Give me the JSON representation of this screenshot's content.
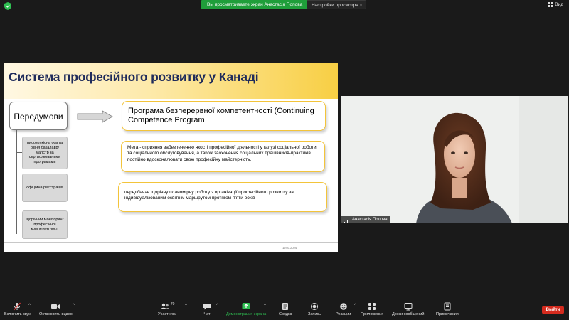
{
  "top_bar": {
    "share_banner": "Вы просматриваете экран Анастасія Попова",
    "view_settings": "Настройки просмотра",
    "view_button": "Вид"
  },
  "slide": {
    "title": "Система професійного розвитку у Канаді",
    "prerequisites_label": "Передумови",
    "prerequisites": [
      "високоякісна освіта рівня бакалавр/магістр за сертифікованими програмами",
      "офіційна реєстрація",
      "щорічний моніторинг професійної компетентності"
    ],
    "program": "Програма безперервної компетентності (Continuing Competence Program",
    "goal": "Мета - сприяння забезпеченню якості професійної діяльності у галузі соціальної роботи та соціального обслуговування, а також заохочення соціальних працівників-практиків постійно вдосконалювати свою професійну майстерність.",
    "plan": "передбачає щорічну планомірну роботу з організації професійного розвитку за індивідуалізованим освітнім маршрутом протягом п'яти років",
    "date": "19.03.2024"
  },
  "video": {
    "participant_name": "Анастасія Попова"
  },
  "toolbar": {
    "unmute": "Включить звук",
    "start_video": "Остановить видео",
    "participants": "Участники",
    "participants_count": "70",
    "chat": "Чат",
    "share_screen": "Демонстрация экрана",
    "summary": "Сводка",
    "record": "Запись",
    "reactions": "Реакции",
    "apps": "Приложения",
    "whiteboards": "Доски сообщений",
    "notes": "Примечания",
    "leave": "Выйти"
  },
  "colors": {
    "accent_green": "#1f9e3a",
    "leave_red": "#d52b1e",
    "slide_title": "#1f2b5b",
    "box_border_yellow": "#f3c43a"
  }
}
